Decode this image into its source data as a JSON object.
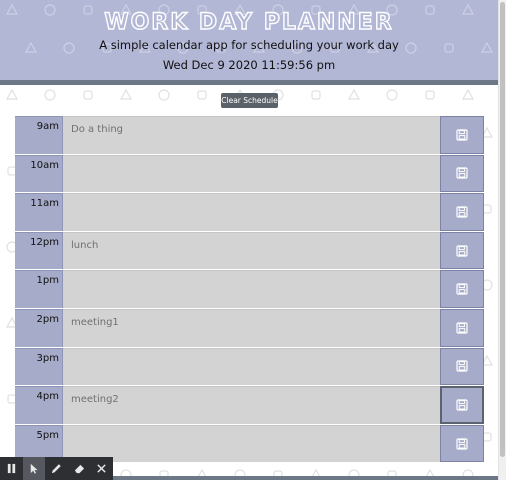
{
  "header": {
    "title": "WORK DAY PLANNER",
    "subtitle": "A simple calendar app for scheduling your work day",
    "datetime": "Wed Dec 9 2020 11:59:56 pm"
  },
  "clear_button_label": "Clear Schedule",
  "rows": [
    {
      "hour": "9am",
      "text": "Do a thing"
    },
    {
      "hour": "10am",
      "text": ""
    },
    {
      "hour": "11am",
      "text": ""
    },
    {
      "hour": "12pm",
      "text": "lunch"
    },
    {
      "hour": "1pm",
      "text": ""
    },
    {
      "hour": "2pm",
      "text": "meeting1"
    },
    {
      "hour": "3pm",
      "text": ""
    },
    {
      "hour": "4pm",
      "text": "meeting2"
    },
    {
      "hour": "5pm",
      "text": ""
    }
  ],
  "colors": {
    "header_bg": "#b3b7d6",
    "hour_bg": "#a6abc9",
    "description_bg": "#d3d3d3",
    "divider": "#6c7885",
    "clear_button_bg": "#5b6168"
  },
  "icons": {
    "save": "floppy-disk-icon",
    "toolbar": [
      "pause-icon",
      "pointer-icon",
      "pencil-icon",
      "eraser-icon",
      "close-icon"
    ]
  }
}
